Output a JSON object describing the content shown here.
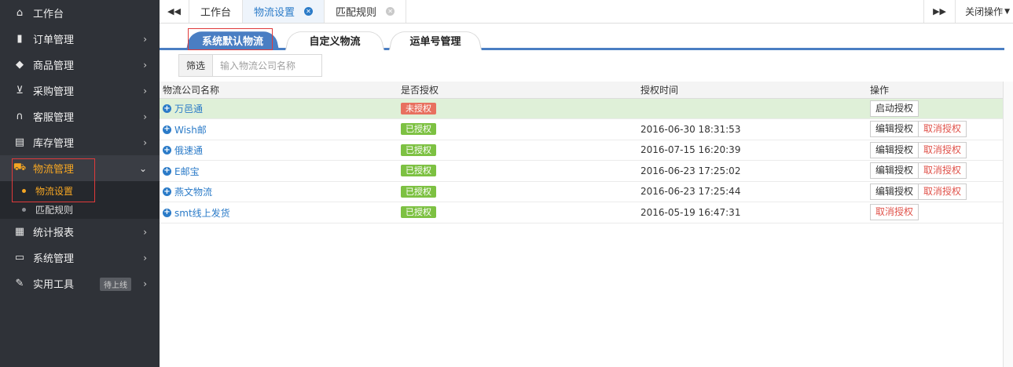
{
  "sidebar": {
    "items": [
      {
        "label": "工作台",
        "icon": "home-icon",
        "glyph": "⌂"
      },
      {
        "label": "订单管理",
        "icon": "clipboard-icon",
        "glyph": "▮"
      },
      {
        "label": "商品管理",
        "icon": "shield-icon",
        "glyph": "◆"
      },
      {
        "label": "采购管理",
        "icon": "cart-icon",
        "glyph": "⊻"
      },
      {
        "label": "客服管理",
        "icon": "headphones-icon",
        "glyph": "∩"
      },
      {
        "label": "库存管理",
        "icon": "storage-icon",
        "glyph": "▤"
      },
      {
        "label": "物流管理",
        "icon": "truck-icon",
        "glyph": "⛟"
      },
      {
        "label": "统计报表",
        "icon": "report-icon",
        "glyph": "▦"
      },
      {
        "label": "系统管理",
        "icon": "monitor-icon",
        "glyph": "▭"
      },
      {
        "label": "实用工具",
        "icon": "wrench-icon",
        "glyph": "✎",
        "badge": "待上线"
      }
    ],
    "logistics_sub": [
      {
        "label": "物流设置"
      },
      {
        "label": "匹配规则"
      }
    ],
    "accent_color": "#f5a623"
  },
  "topbar": {
    "tabs": [
      {
        "label": "工作台"
      },
      {
        "label": "物流设置"
      },
      {
        "label": "匹配规则"
      }
    ],
    "close_ops_label": "关闭操作"
  },
  "subtabs": [
    {
      "label": "系统默认物流"
    },
    {
      "label": "自定义物流"
    },
    {
      "label": "运单号管理"
    }
  ],
  "filter": {
    "label": "筛选",
    "placeholder": "输入物流公司名称"
  },
  "table": {
    "headers": [
      "物流公司名称",
      "是否授权",
      "授权时间",
      "操作"
    ],
    "rows": [
      {
        "name": "万邑通",
        "status": "未授权",
        "time": "",
        "ops": [
          "启动授权"
        ]
      },
      {
        "name": "Wish邮",
        "status": "已授权",
        "time": "2016-06-30 18:31:53",
        "ops": [
          "编辑授权",
          "取消授权"
        ]
      },
      {
        "name": "俄速通",
        "status": "已授权",
        "time": "2016-07-15 16:20:39",
        "ops": [
          "编辑授权",
          "取消授权"
        ]
      },
      {
        "name": "E邮宝",
        "status": "已授权",
        "time": "2016-06-23 17:25:02",
        "ops": [
          "编辑授权",
          "取消授权"
        ]
      },
      {
        "name": "燕文物流",
        "status": "已授权",
        "time": "2016-06-23 17:25:44",
        "ops": [
          "编辑授权",
          "取消授权"
        ]
      },
      {
        "name": "smt线上发货",
        "status": "已授权",
        "time": "2016-05-19 16:47:31",
        "ops": [
          "取消授权"
        ]
      }
    ]
  },
  "colors": {
    "primary": "#2b7bc8",
    "tab_blue": "#4a7ec3",
    "authorized": "#7dc142",
    "unauthorized": "#e8705f",
    "danger": "#e0524a",
    "highlight_row": "#dff0d8"
  }
}
